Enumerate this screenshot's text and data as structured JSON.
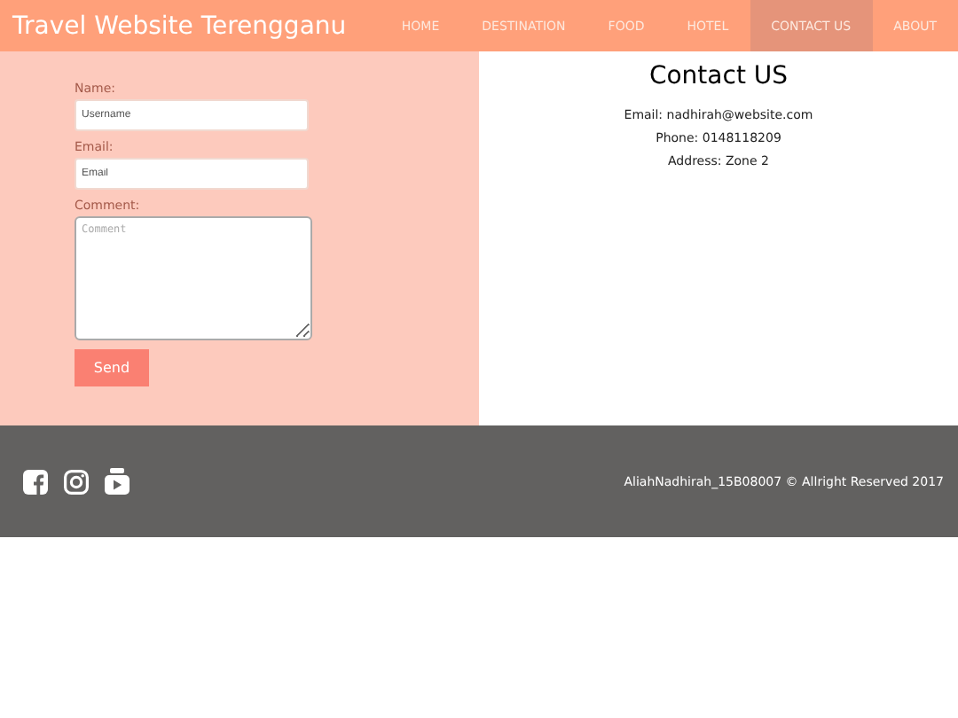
{
  "header": {
    "title": "Travel Website Terengganu"
  },
  "nav": [
    {
      "label": "HOME",
      "selected": false
    },
    {
      "label": "DESTINATION",
      "selected": false
    },
    {
      "label": "FOOD",
      "selected": false
    },
    {
      "label": "HOTEL",
      "selected": false
    },
    {
      "label": "CONTACT US",
      "selected": true
    },
    {
      "label": "ABOUT",
      "selected": false
    }
  ],
  "form": {
    "fields": [
      {
        "label": "Name:",
        "placeholder": "Username",
        "kind": "input"
      },
      {
        "label": "Email:",
        "placeholder": "Email",
        "kind": "input"
      },
      {
        "label": "Comment:",
        "placeholder": "Comment",
        "kind": "textarea"
      }
    ],
    "submit": "Send"
  },
  "contact": {
    "title": "Contact US",
    "lines": [
      "Email: nadhirah@website.com",
      "Phone: 0148118209",
      "Address: Zone 2"
    ]
  },
  "footer": {
    "social": [
      {
        "kind": "facebook"
      },
      {
        "kind": "instagram"
      },
      {
        "kind": "youtube"
      }
    ],
    "copyright": "AliahNadhirah_15B08007 © Allright Reserved 2017"
  }
}
